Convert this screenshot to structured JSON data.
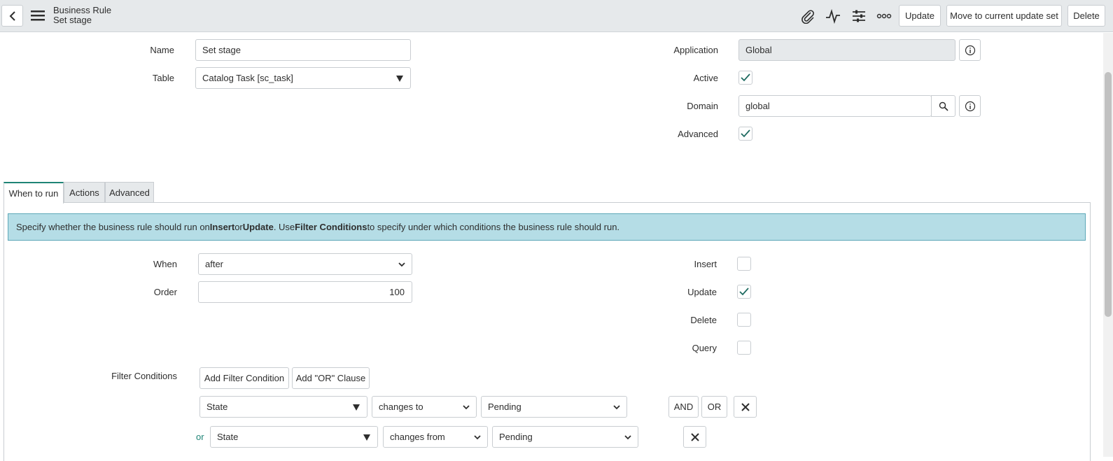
{
  "header": {
    "record_type": "Business Rule",
    "record_name": "Set stage",
    "update_label": "Update",
    "move_label": "Move to current update set",
    "delete_label": "Delete"
  },
  "form": {
    "name_label": "Name",
    "name_value": "Set stage",
    "table_label": "Table",
    "table_value": "Catalog Task [sc_task]",
    "application_label": "Application",
    "application_value": "Global",
    "active_label": "Active",
    "active_checked": true,
    "domain_label": "Domain",
    "domain_value": "global",
    "advanced_label": "Advanced",
    "advanced_checked": true
  },
  "tabs": [
    {
      "label": "When to run",
      "active": true
    },
    {
      "label": "Actions",
      "active": false
    },
    {
      "label": "Advanced",
      "active": false
    }
  ],
  "info_banner": {
    "part1": "Specify whether the business rule should run on ",
    "insert": "Insert",
    "part2": " or ",
    "update": "Update",
    "part3": ". Use ",
    "filter": "Filter Conditions",
    "part4": " to specify under which conditions the business rule should run."
  },
  "when_to_run": {
    "when_label": "When",
    "when_value": "after",
    "order_label": "Order",
    "order_value": "100",
    "insert_label": "Insert",
    "insert_checked": false,
    "update_label": "Update",
    "update_checked": true,
    "delete_label": "Delete",
    "delete_checked": false,
    "query_label": "Query",
    "query_checked": false
  },
  "filter": {
    "label": "Filter Conditions",
    "add_condition": "Add Filter Condition",
    "add_or": "Add \"OR\" Clause",
    "and_label": "AND",
    "or_label": "OR",
    "or_prefix": "or",
    "conditions": [
      {
        "field": "State",
        "operator": "changes to",
        "value": "Pending"
      },
      {
        "field": "State",
        "operator": "changes from",
        "value": "Pending"
      }
    ]
  },
  "colors": {
    "accent": "#1f8476",
    "banner_bg": "#b5dde6",
    "header_bg": "#e6e9eb"
  }
}
